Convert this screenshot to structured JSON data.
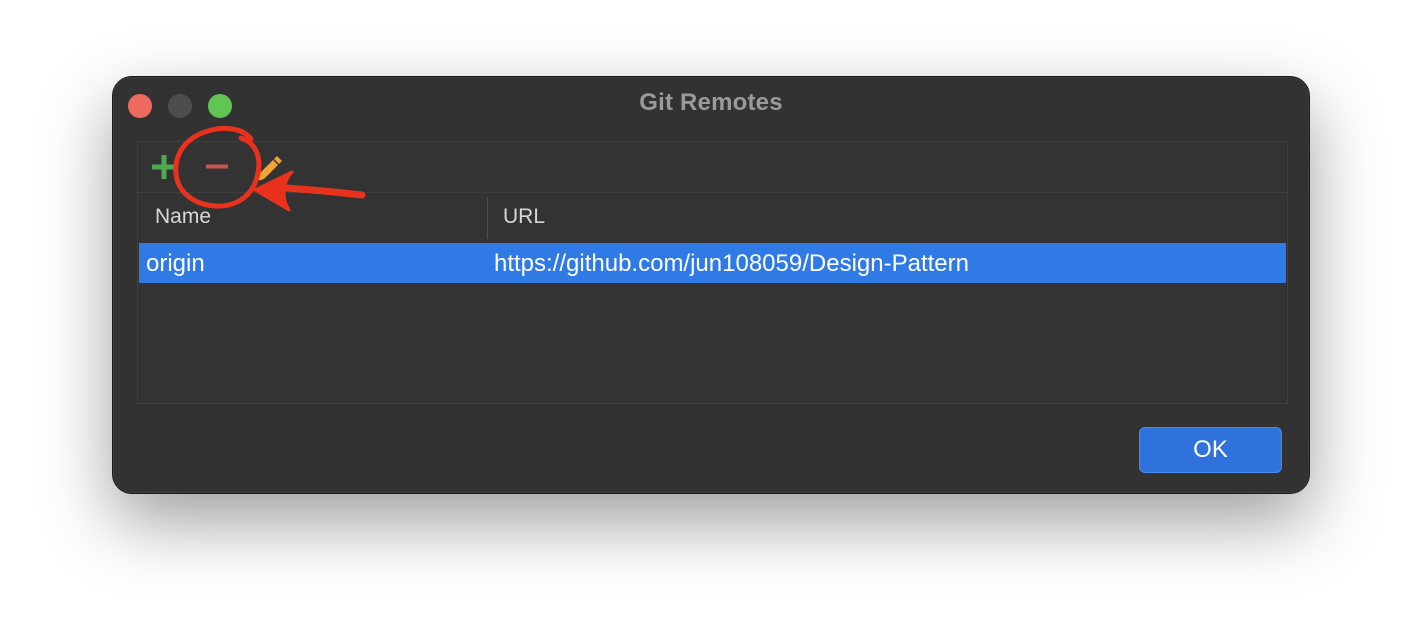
{
  "window": {
    "title": "Git Remotes"
  },
  "toolbar": {
    "add_icon": "plus-icon",
    "remove_icon": "minus-icon",
    "edit_icon": "pencil-icon"
  },
  "table": {
    "columns": [
      "Name",
      "URL"
    ],
    "rows": [
      {
        "name": "origin",
        "url": "https://github.com/jun108059/Design-Pattern"
      }
    ]
  },
  "buttons": {
    "ok_label": "OK"
  },
  "colors": {
    "window_bg": "#323232",
    "selection": "#2f7ae5",
    "add_icon": "#4ea84e",
    "remove_icon": "#c75450",
    "edit_icon": "#f2a432",
    "annotation": "#e8321e"
  }
}
